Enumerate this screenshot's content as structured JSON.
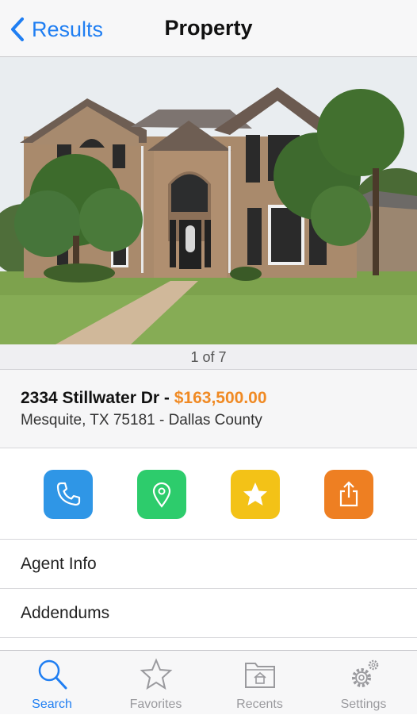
{
  "nav": {
    "back_label": "Results",
    "title": "Property"
  },
  "photo": {
    "pager": "1 of 7"
  },
  "listing": {
    "street": "2334 Stillwater Dr - ",
    "price": "$163,500.00",
    "location": "Mesquite, TX 75181 - Dallas County"
  },
  "actions": [
    {
      "icon": "phone-icon",
      "color": "#2f96e6"
    },
    {
      "icon": "map-pin-icon",
      "color": "#2dcc6c"
    },
    {
      "icon": "star-icon",
      "color": "#f3c217"
    },
    {
      "icon": "share-icon",
      "color": "#ee7f22"
    }
  ],
  "rows": [
    "Agent Info",
    "Addendums"
  ],
  "tabs": [
    {
      "label": "Search",
      "icon": "search-icon",
      "active": true
    },
    {
      "label": "Favorites",
      "icon": "star-outline-icon",
      "active": false
    },
    {
      "label": "Recents",
      "icon": "folder-home-icon",
      "active": false
    },
    {
      "label": "Settings",
      "icon": "gears-icon",
      "active": false
    }
  ],
  "colors": {
    "accent": "#1f7ef2",
    "price": "#f08a24"
  }
}
